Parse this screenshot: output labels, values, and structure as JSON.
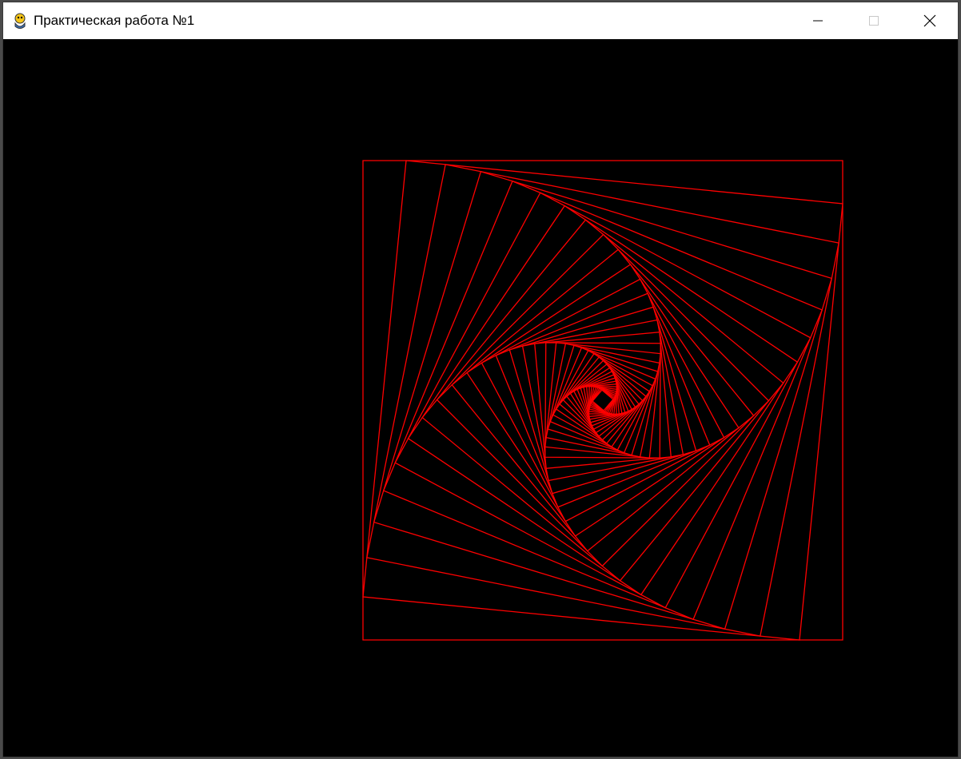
{
  "window": {
    "title": "Практическая работа №1",
    "app_icon": "pygame-snake-icon",
    "controls": {
      "minimize_icon": "minimize-icon",
      "maximize_icon": "maximize-icon",
      "close_icon": "close-icon"
    }
  },
  "canvas": {
    "background_color": "#000000",
    "stroke_color": "#ff0000",
    "figure": "nested-rotating-squares",
    "square_count": 40
  }
}
